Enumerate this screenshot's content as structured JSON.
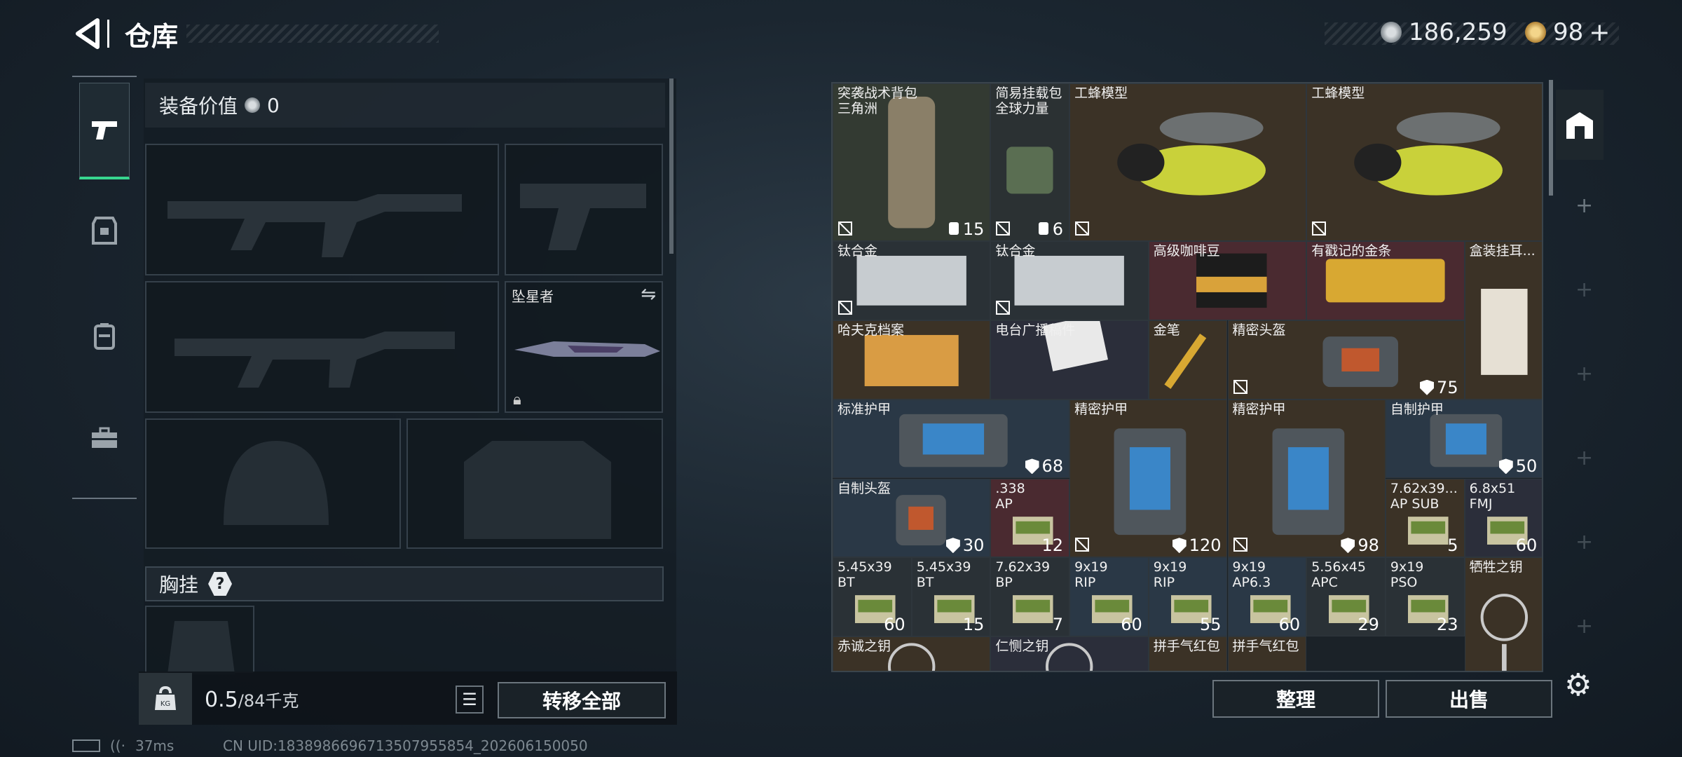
{
  "header": {
    "title": "仓库",
    "currency_1": "186,259",
    "currency_2": "98"
  },
  "left_panel": {
    "equip_value_label": "装备价值",
    "equip_value": "0",
    "melee_name": "坠星者",
    "chest_rig_label": "胸挂",
    "chest_rig_help": "?",
    "weight_value": "0.5",
    "weight_cap": "/84千克",
    "transfer_all": "转移全部"
  },
  "grid": {
    "items": [
      {
        "name": "突袭战术背包\n三角洲",
        "count": "15",
        "count_icon": "backpack",
        "nodrop": true
      },
      {
        "name": "简易挂载包\n全球力量",
        "count": "6",
        "count_icon": "vest",
        "nodrop": true
      },
      {
        "name": "工蜂模型",
        "nodrop": true
      },
      {
        "name": "工蜂模型",
        "nodrop": true
      },
      {
        "name": "钛合金",
        "nodrop": true
      },
      {
        "name": "钛合金",
        "nodrop": true
      },
      {
        "name": "高级咖啡豆"
      },
      {
        "name": "有戳记的金条"
      },
      {
        "name": "盒装挂耳..."
      },
      {
        "name": "哈夫克档案"
      },
      {
        "name": "电台广播稿件"
      },
      {
        "name": "金笔"
      },
      {
        "name": "精密头盔",
        "count": "75",
        "shield": true,
        "nodrop": true
      },
      {
        "name": "标准护甲",
        "count": "68",
        "shield": true
      },
      {
        "name": "精密护甲",
        "count": "120",
        "shield": true,
        "nodrop": true
      },
      {
        "name": "精密护甲",
        "count": "98",
        "shield": true,
        "nodrop": true
      },
      {
        "name": "自制护甲",
        "count": "50",
        "shield": true
      },
      {
        "name": "自制头盔",
        "count": "30",
        "shield": true
      },
      {
        "name": ".338\nAP",
        "count": "12"
      },
      {
        "name": "7.62x39...\nAP SUB",
        "count": "5"
      },
      {
        "name": "6.8x51\nFMJ",
        "count": "60"
      },
      {
        "name": "5.45x39\nBT",
        "count": "60"
      },
      {
        "name": "5.45x39\nBT",
        "count": "15"
      },
      {
        "name": "7.62x39\nBP",
        "count": "7"
      },
      {
        "name": "9x19\nRIP",
        "count": "60"
      },
      {
        "name": "9x19\nRIP",
        "count": "55"
      },
      {
        "name": "9x19\nAP6.3",
        "count": "60"
      },
      {
        "name": "5.56x45\nAPC",
        "count": "29"
      },
      {
        "name": "9x19\nPSO",
        "count": "23"
      },
      {
        "name": "牺牲之钥"
      },
      {
        "name": "赤诚之钥"
      },
      {
        "name": "仁恻之钥"
      },
      {
        "name": "拼手气红包"
      },
      {
        "name": "拼手气红包"
      }
    ]
  },
  "buttons": {
    "sort": "整理",
    "sell": "出售"
  },
  "status": {
    "ping": "37ms",
    "uid": "CN UID:1838986696713507955854_202606150050"
  },
  "colors": {
    "accent": "#37d68f",
    "grid_bg": "#1b2228"
  }
}
